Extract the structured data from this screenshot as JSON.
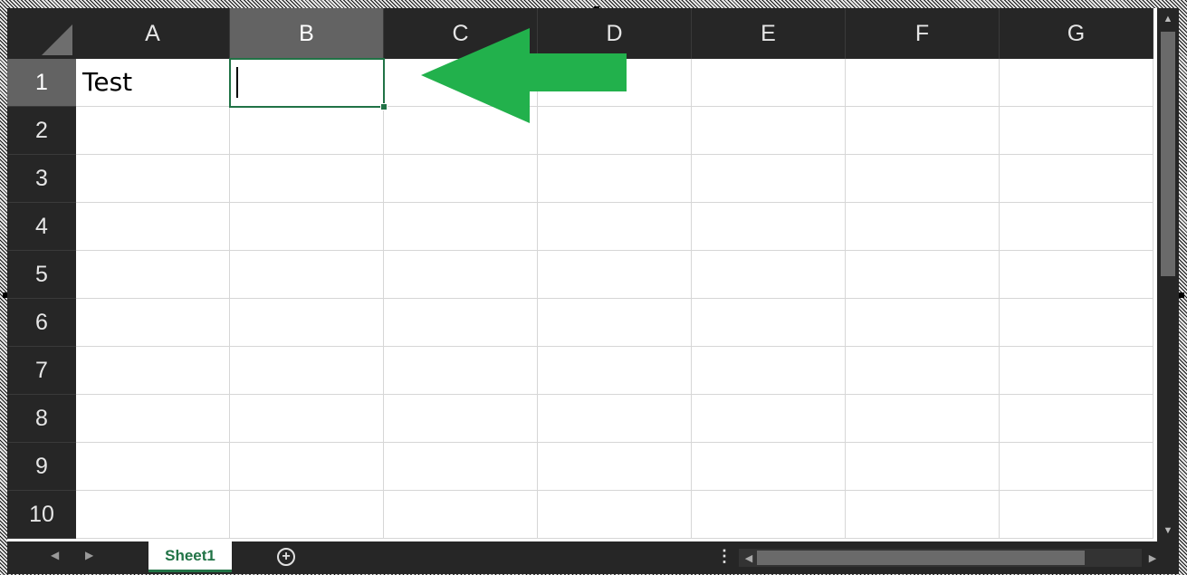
{
  "spreadsheet": {
    "columns": [
      "A",
      "B",
      "C",
      "D",
      "E",
      "F",
      "G"
    ],
    "rows": [
      "1",
      "2",
      "3",
      "4",
      "5",
      "6",
      "7",
      "8",
      "9",
      "10"
    ],
    "selected_column": "B",
    "selected_row": "1",
    "cells": {
      "A1": "Test",
      "B1": ""
    }
  },
  "sheet_tabs": {
    "active": "Sheet1",
    "add_label": "+"
  },
  "annotation": {
    "arrow_color": "#22b14c"
  },
  "colors": {
    "excel_green": "#217346",
    "header_bg": "#262626",
    "selected_header_bg": "#636363"
  }
}
